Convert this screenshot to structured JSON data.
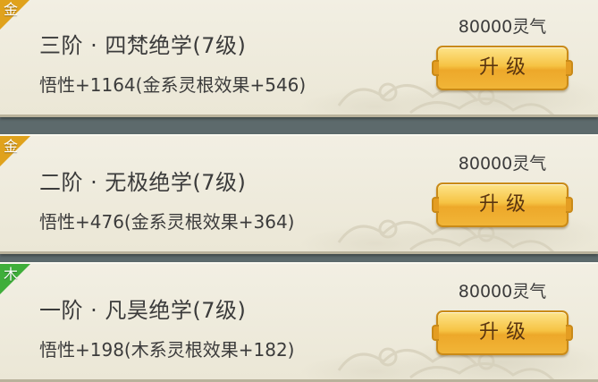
{
  "skills": [
    {
      "element_char": "金",
      "element_color": "#e0a21c",
      "title": "三阶 · 四梵绝学(7级)",
      "effect": "悟性+1164(金系灵根效果+546)",
      "cost": "80000灵气",
      "button_label": "升级"
    },
    {
      "element_char": "金",
      "element_color": "#e0a21c",
      "title": "二阶 · 无极绝学(7级)",
      "effect": "悟性+476(金系灵根效果+364)",
      "cost": "80000灵气",
      "button_label": "升级"
    },
    {
      "element_char": "木",
      "element_color": "#3fae3a",
      "title": "一阶 · 凡昊绝学(7级)",
      "effect": "悟性+198(木系灵根效果+182)",
      "cost": "80000灵气",
      "button_label": "升级"
    }
  ]
}
